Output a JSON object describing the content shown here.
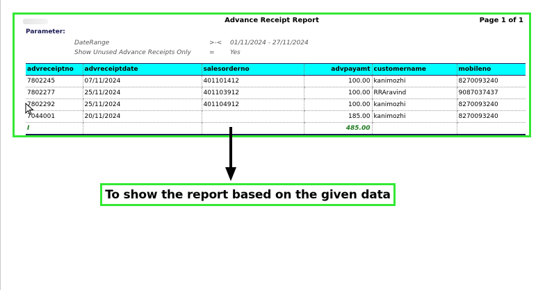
{
  "report": {
    "title": "Advance Receipt Report",
    "page": "Page 1 of 1",
    "parameter_label": "Parameter:",
    "params": [
      {
        "name": "DateRange",
        "op": ">-<",
        "value": "01/11/2024 - 27/11/2024"
      },
      {
        "name": "Show Unused Advance Receipts Only",
        "op": "=",
        "value": "Yes"
      }
    ]
  },
  "table": {
    "headers": [
      "advreceiptno",
      "advreceiptdate",
      "salesorderno",
      "advpayamt",
      "customername",
      "mobileno"
    ],
    "rows": [
      [
        "7802245",
        "07/11/2024",
        "401101412",
        "100.00",
        "kanimozhi",
        "8270093240"
      ],
      [
        "7802277",
        "25/11/2024",
        "401103912",
        "100.00",
        "RRAravind",
        "9087037437"
      ],
      [
        "7802292",
        "25/11/2024",
        "401104912",
        "100.00",
        "kanimozhi",
        "8270093240"
      ],
      [
        "7044001",
        "20/11/2024",
        "",
        "185.00",
        "kanimozhi",
        "8270093240"
      ]
    ],
    "footer": [
      "I",
      "",
      "",
      "485.00",
      "",
      ""
    ]
  },
  "caption": "To show the report based on the given data",
  "colors": {
    "highlight_border": "#33e833",
    "header_bg": "#00ffff",
    "total_text": "#1e7a1e"
  }
}
